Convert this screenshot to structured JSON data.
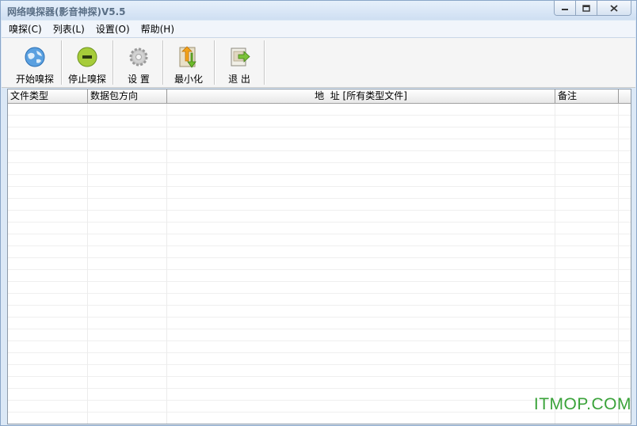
{
  "window": {
    "title": "网络嗅探器(影音神探)V5.5"
  },
  "menu": [
    {
      "label": "嗅探(C)"
    },
    {
      "label": "列表(L)"
    },
    {
      "label": "设置(O)"
    },
    {
      "label": "帮助(H)"
    }
  ],
  "toolbar": {
    "start_label": "开始嗅探",
    "stop_label": "停止嗅探",
    "settings_label": "设 置",
    "minimize_label": "最小化",
    "exit_label": "退 出"
  },
  "list": {
    "columns": [
      {
        "label": "文件类型"
      },
      {
        "label": "数据包方向"
      },
      {
        "label": "地  址 [所有类型文件]"
      },
      {
        "label": "备注"
      }
    ]
  },
  "watermark": "ITMOP.COM",
  "colors": {
    "title_text": "#5a6f86",
    "watermark": "#3aa33a"
  }
}
